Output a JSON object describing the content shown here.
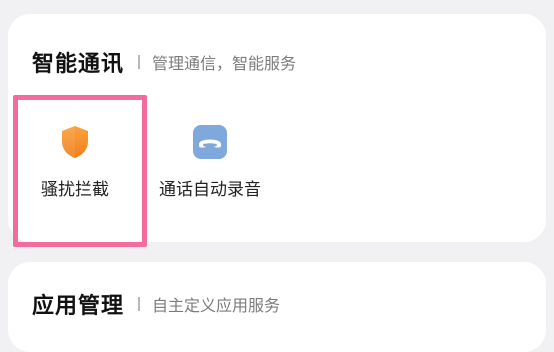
{
  "sections": [
    {
      "title": "智能通讯",
      "subtitle": "管理通信，智能服务",
      "features": [
        {
          "label": "骚扰拦截",
          "icon": "shield-icon",
          "highlighted": true
        },
        {
          "label": "通话自动录音",
          "icon": "phone-record-icon",
          "highlighted": false
        }
      ]
    },
    {
      "title": "应用管理",
      "subtitle": "自主定义应用服务"
    }
  ],
  "colors": {
    "background": "#f1f1f3",
    "card": "#ffffff",
    "highlight_border": "#f46c9d",
    "shield_orange": "#f7932e",
    "phone_tile_blue": "#7fa8dc"
  }
}
